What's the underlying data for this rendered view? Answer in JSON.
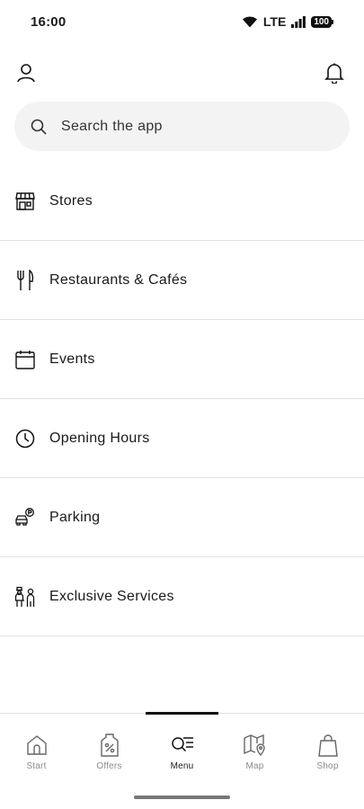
{
  "status_bar": {
    "time": "16:00",
    "network": "LTE",
    "battery": "100"
  },
  "header": {
    "profile_icon": "person-icon",
    "notifications_icon": "bell-icon"
  },
  "search": {
    "placeholder": "Search the app",
    "icon": "search-icon"
  },
  "menu": {
    "items": [
      {
        "label": "Stores",
        "icon": "storefront-icon"
      },
      {
        "label": "Restaurants & Cafés",
        "icon": "fork-knife-icon"
      },
      {
        "label": "Events",
        "icon": "calendar-icon"
      },
      {
        "label": "Opening Hours",
        "icon": "clock-icon"
      },
      {
        "label": "Parking",
        "icon": "car-parking-icon"
      },
      {
        "label": "Exclusive Services",
        "icon": "concierge-icon"
      }
    ]
  },
  "bottom_nav": {
    "active": "Menu",
    "tabs": [
      {
        "label": "Start",
        "icon": "home-icon"
      },
      {
        "label": "Offers",
        "icon": "percent-tag-icon"
      },
      {
        "label": "Menu",
        "icon": "menu-search-icon"
      },
      {
        "label": "Map",
        "icon": "map-pin-icon"
      },
      {
        "label": "Shop",
        "icon": "shopping-bag-icon"
      }
    ]
  },
  "colors": {
    "text": "#1a1a1a",
    "search_bg": "#f3f3f3",
    "divider": "#e2e2e2",
    "inactive_nav": "#8a8a8a"
  }
}
